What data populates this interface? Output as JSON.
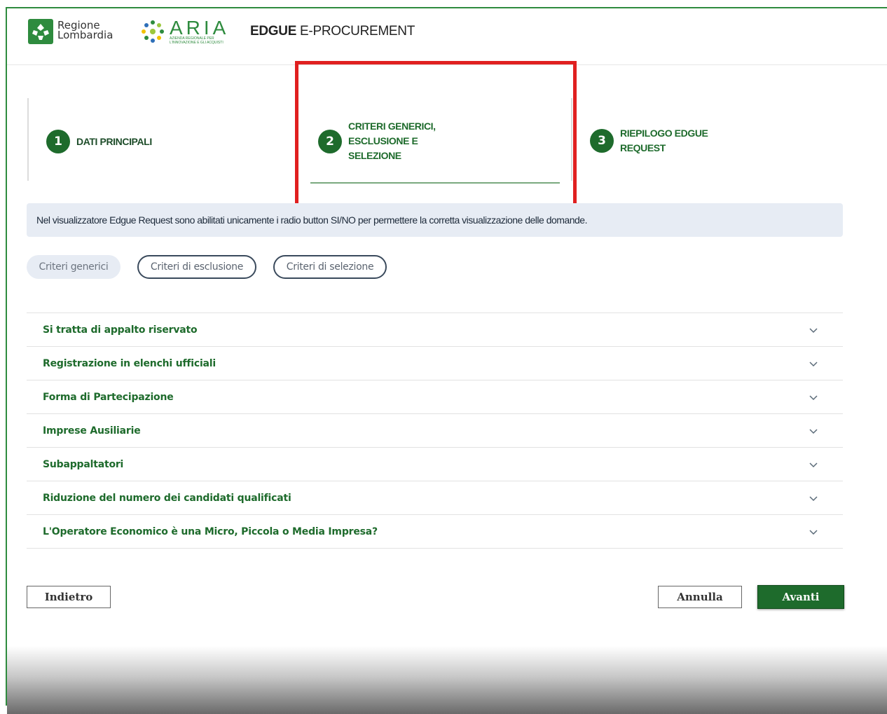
{
  "header": {
    "region_logo_text_line1": "Regione",
    "region_logo_text_line2": "Lombardia",
    "aria_logo_text": "ARIA",
    "aria_logo_subtext": "AZIENDA REGIONALE PER L'INNOVAZIONE E GLI ACQUISTI",
    "app_title_bold": "EDGUE",
    "app_title_rest": " E-PROCUREMENT"
  },
  "stepper": {
    "steps": [
      {
        "number": "1",
        "label": "DATI PRINCIPALI"
      },
      {
        "number": "2",
        "label": "CRITERI GENERICI, ESCLUSIONE E SELEZIONE"
      },
      {
        "number": "3",
        "label": "RIEPILOGO EDGUE REQUEST"
      }
    ],
    "active_step": 2
  },
  "info_banner": "Nel visualizzatore Edgue Request sono abilitati unicamente i radio button SI/NO per permettere la corretta visualizzazione delle domande.",
  "filters": {
    "items": [
      "Criteri generici",
      "Criteri di esclusione",
      "Criteri di selezione"
    ],
    "selected": "Criteri generici"
  },
  "accordion": {
    "items": [
      "Si tratta di appalto riservato",
      "Registrazione in elenchi ufficiali",
      "Forma di Partecipazione",
      "Imprese Ausiliarie",
      "Subappaltatori",
      "Riduzione del numero dei candidati qualificati",
      "L'Operatore Economico è una Micro, Piccola o Media Impresa?"
    ]
  },
  "footer": {
    "back_label": "Indietro",
    "cancel_label": "Annulla",
    "next_label": "Avanti"
  },
  "colors": {
    "primary_green": "#1e6b2c",
    "highlight_red": "#e02020",
    "banner_bg": "#e7ecf4"
  },
  "icons": {
    "region_logo": "regione-lombardia-logo-icon",
    "aria_logo": "aria-logo-icon",
    "accordion_toggle": "chevron-down-icon"
  }
}
